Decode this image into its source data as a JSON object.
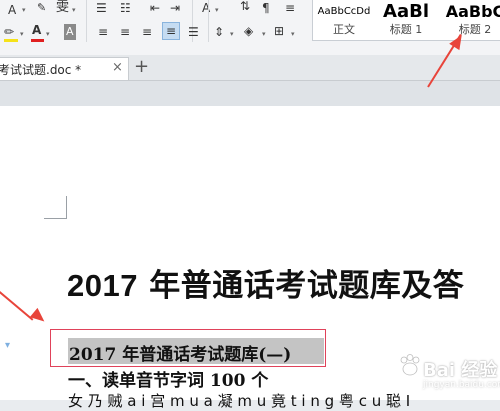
{
  "ribbon": {
    "row1": {
      "font_a_small": "A",
      "font_a_caret": "▾",
      "phonetic": "雯",
      "format_painter_icon": "format-painter-icon"
    },
    "row2": {
      "highlight_label": "",
      "font_color_label": "A",
      "font_color_accent": "#e02020",
      "highlight_accent": "#f5e21a"
    },
    "styles": [
      {
        "sample": "AaBbCcDd",
        "label": "正文"
      },
      {
        "sample": "AaBl",
        "label": "标题 1"
      },
      {
        "sample": "AaBbC",
        "label": "标题 2"
      }
    ]
  },
  "tabs": {
    "document_title": "考试试题.doc *",
    "close_glyph": "×",
    "add_glyph": "+"
  },
  "document": {
    "title_num": "2017",
    "title_rest": " 年普通话考试题库及答",
    "heading": "2017 年普通话考试题库(—)",
    "section_1": "一、读单音节字词 100 个",
    "body_line": "女 乃 贼 a i 宫 m u a 凝 m u 竟 t i n g 粤 c u 聪 I"
  },
  "colors": {
    "annotation": "#e8443a",
    "selection_box": "#e0425a",
    "highlight_gray": "#c4c4c4"
  },
  "watermark": {
    "brand": "Bai 经验",
    "sub": "jingyan.baidu.com"
  }
}
